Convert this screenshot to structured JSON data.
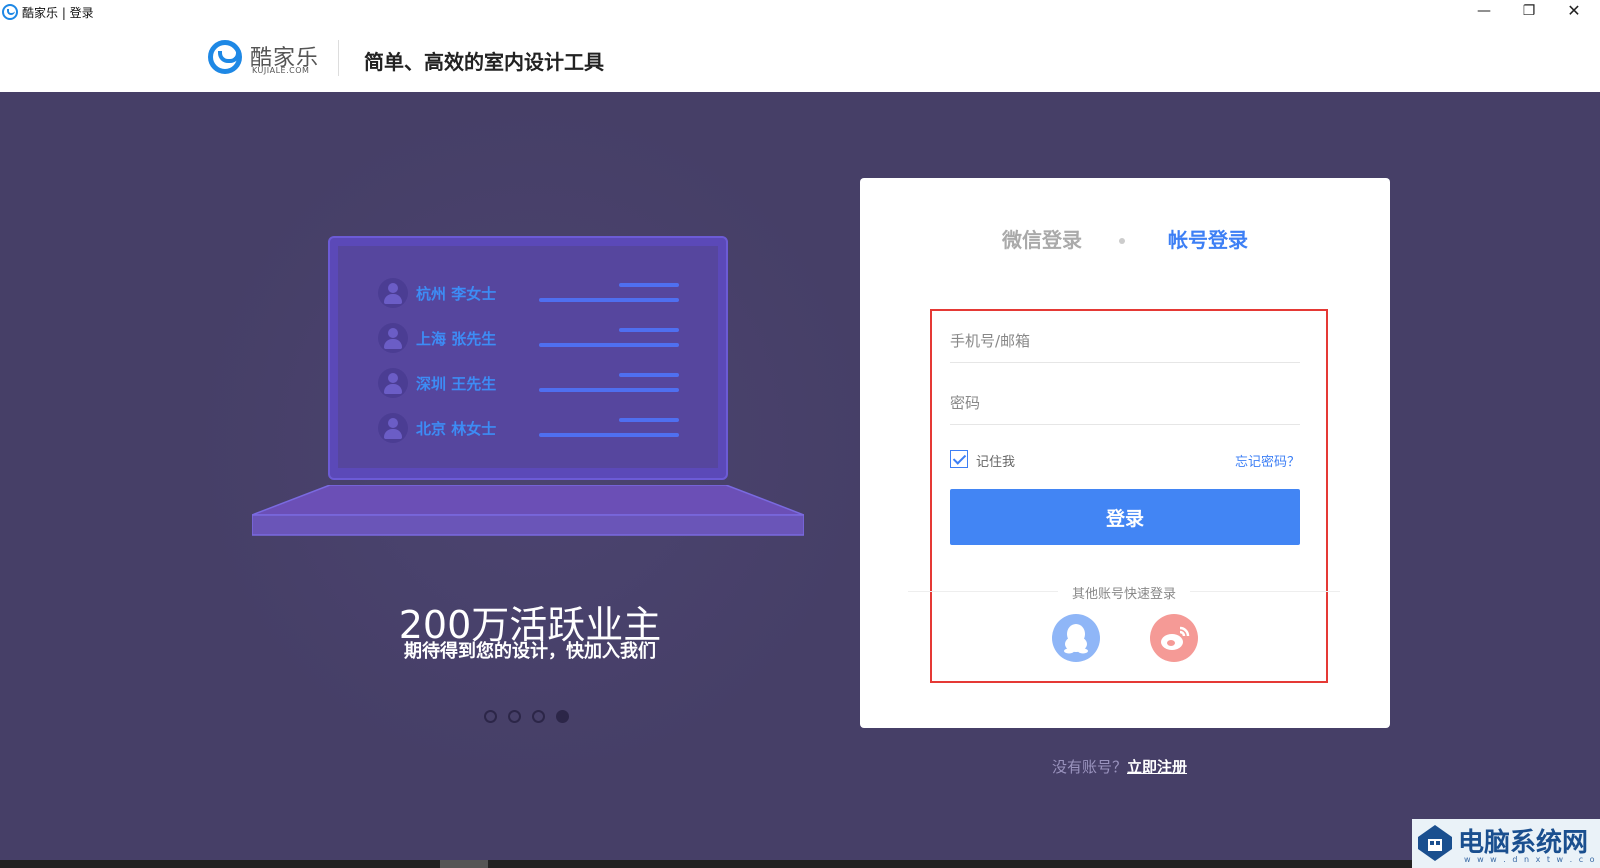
{
  "window": {
    "title": "酷家乐 | 登录",
    "minimize_glyph": "—",
    "restore_glyph": "❐",
    "close_glyph": "✕"
  },
  "header": {
    "logo_text": "酷家乐",
    "logo_sub": "KUJIALE.COM",
    "tagline": "简单、高效的室内设计工具"
  },
  "showcase": {
    "users": [
      {
        "name": "杭州  李女士"
      },
      {
        "name": "上海  张先生"
      },
      {
        "name": "深圳  王先生"
      },
      {
        "name": "北京  林女士"
      }
    ],
    "headline": "200万活跃业主",
    "subline": "期待得到您的设计，快加入我们",
    "carousel": {
      "count": 4,
      "active_index": 3
    }
  },
  "login": {
    "tabs": [
      {
        "label": "微信登录",
        "active": false
      },
      {
        "label": "帐号登录",
        "active": true
      }
    ],
    "username_placeholder": "手机号/邮箱",
    "password_placeholder": "密码",
    "remember_label": "记住我",
    "remember_checked": true,
    "forgot_label": "忘记密码？",
    "submit_label": "登录",
    "other_label": "其他账号快速登录",
    "social": [
      {
        "name": "qq",
        "icon": "qq-icon",
        "color": "#8fb6f7"
      },
      {
        "name": "weibo",
        "icon": "weibo-icon",
        "color": "#f59a96"
      }
    ],
    "highlight_color": "#e53935"
  },
  "register": {
    "prompt": "没有账号？",
    "link": "立即注册"
  },
  "watermark": {
    "text": "电脑系统网",
    "sub": "w w w . d n x t w . c o m"
  },
  "colors": {
    "accent": "#4285f4",
    "background": "#463f67"
  }
}
